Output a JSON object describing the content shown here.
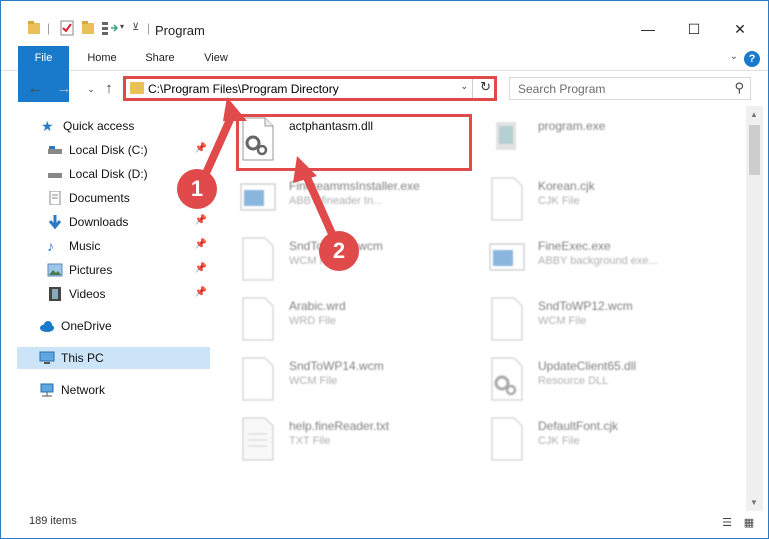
{
  "window": {
    "title": "Program",
    "controls": {
      "minimize": "—",
      "maximize": "☐",
      "close": "✕"
    }
  },
  "ribbon": {
    "tabs": [
      {
        "label": "File"
      },
      {
        "label": "Home"
      },
      {
        "label": "Share"
      },
      {
        "label": "View"
      }
    ],
    "help": "?"
  },
  "navigation": {
    "address_path": "C:\\Program Files\\Program Directory",
    "search_placeholder": "Search Program"
  },
  "sidebar": {
    "items": [
      {
        "label": "Quick access",
        "icon": "star-icon",
        "pinned": false
      },
      {
        "label": "Local Disk (C:)",
        "icon": "drive-icon",
        "pinned": true
      },
      {
        "label": "Local Disk (D:)",
        "icon": "drive-icon",
        "pinned": false
      },
      {
        "label": "Documents",
        "icon": "documents-icon",
        "pinned": true
      },
      {
        "label": "Downloads",
        "icon": "download-arrow-icon",
        "pinned": true
      },
      {
        "label": "Music",
        "icon": "music-note-icon",
        "pinned": true
      },
      {
        "label": "Pictures",
        "icon": "pictures-icon",
        "pinned": true
      },
      {
        "label": "Videos",
        "icon": "videos-icon",
        "pinned": true
      },
      {
        "label": "OneDrive",
        "icon": "cloud-icon",
        "pinned": false
      },
      {
        "label": "This PC",
        "icon": "monitor-icon",
        "pinned": false,
        "selected": true
      },
      {
        "label": "Network",
        "icon": "network-icon",
        "pinned": false
      }
    ]
  },
  "files": [
    {
      "name": "actphantasm.dll",
      "type": "",
      "icon": "gear-document-icon",
      "highlighted": true
    },
    {
      "name": "program.exe",
      "type": "",
      "icon": "application-icon"
    },
    {
      "name": "FinereammsInstaller.exe",
      "type": "ABBY fineader tn...",
      "icon": "window-app-icon"
    },
    {
      "name": "Korean.cjk",
      "type": "CJK File",
      "icon": "blank-document-icon"
    },
    {
      "name": "SndToWP11.wcm",
      "type": "WCM File",
      "icon": "blank-document-icon"
    },
    {
      "name": "FineExec.exe",
      "type": "ABBY background exe...",
      "icon": "window-app-icon"
    },
    {
      "name": "Arabic.wrd",
      "type": "WRD File",
      "icon": "blank-document-icon"
    },
    {
      "name": "SndToWP12.wcm",
      "type": "WCM File",
      "icon": "blank-document-icon"
    },
    {
      "name": "SndToWP14.wcm",
      "type": "WCM File",
      "icon": "blank-document-icon"
    },
    {
      "name": "UpdateClient65.dll",
      "type": "Resource DLL",
      "icon": "gear-document-icon"
    },
    {
      "name": "help.fineReader.txt",
      "type": "TXT File",
      "icon": "text-document-icon"
    },
    {
      "name": "DefaultFont.cjk",
      "type": "CJK File",
      "icon": "blank-document-icon"
    }
  ],
  "status_bar": {
    "item_count": "189 items"
  },
  "annotations": {
    "marker_1": "1",
    "marker_2": "2",
    "accent_color": "#e04a4a"
  },
  "colors": {
    "accent": "#1979ca",
    "selection": "#cce4f7",
    "folder": "#e9c05a"
  }
}
